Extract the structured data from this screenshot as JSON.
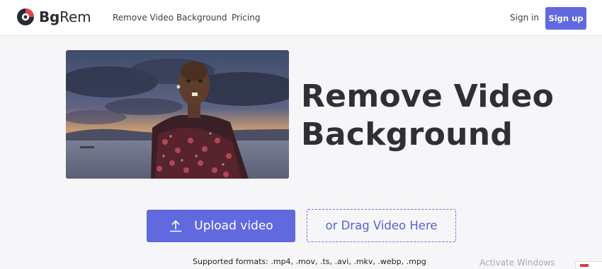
{
  "brand": {
    "name_bold": "Bg",
    "name_regular": "Rem",
    "icon": "bgrem-logo-icon",
    "accent_color": "#6169df"
  },
  "nav": {
    "remove_video_background": "Remove Video Background",
    "pricing": "Pricing",
    "sign_in": "Sign in",
    "sign_up": "Sign up"
  },
  "hero": {
    "image": "person-with-sky-background-preview",
    "title_line1": "Remove Video",
    "title_line2": "Background"
  },
  "upload": {
    "button_label": "Upload video",
    "button_icon": "upload-arrow-icon",
    "drop_label": "or Drag Video Here",
    "formats": "Supported formats: .mp4, .mov, .ts, .avi, .mkv, .webp, .mpg"
  },
  "os_overlay": {
    "activate_text": "Activate Windows"
  }
}
